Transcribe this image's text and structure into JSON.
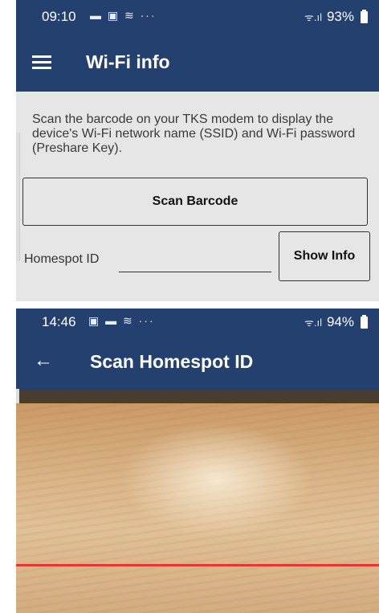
{
  "screen1": {
    "status_bar": {
      "time": "09:10",
      "notification_icons": [
        "photo-icon",
        "gallery-icon",
        "wifi-free-icon",
        "more-icon"
      ],
      "signal_icons": "ᯤ.ıl",
      "battery": "93%"
    },
    "app_bar": {
      "title": "Wi-Fi info"
    },
    "description": "Scan the barcode on your TKS modem to display the device's Wi-Fi network name (SSID) and Wi-Fi password (Preshare Key).",
    "scan_button_label": "Scan Barcode",
    "homespot_label": "Homespot ID",
    "homespot_value": "",
    "show_info_label": "Show Info"
  },
  "screen2": {
    "status_bar": {
      "time": "14:46",
      "notification_icons": [
        "gallery-icon",
        "photo-icon",
        "wifi-free-icon",
        "more-icon"
      ],
      "signal_icons": "ᯤ.ıl",
      "battery": "94%"
    },
    "app_bar": {
      "title": "Scan Homespot ID",
      "back_icon": "back-arrow-icon"
    }
  },
  "colors": {
    "app_bar": "#24406e",
    "background": "#e6e6e6",
    "scan_line": "#e53a2b"
  }
}
